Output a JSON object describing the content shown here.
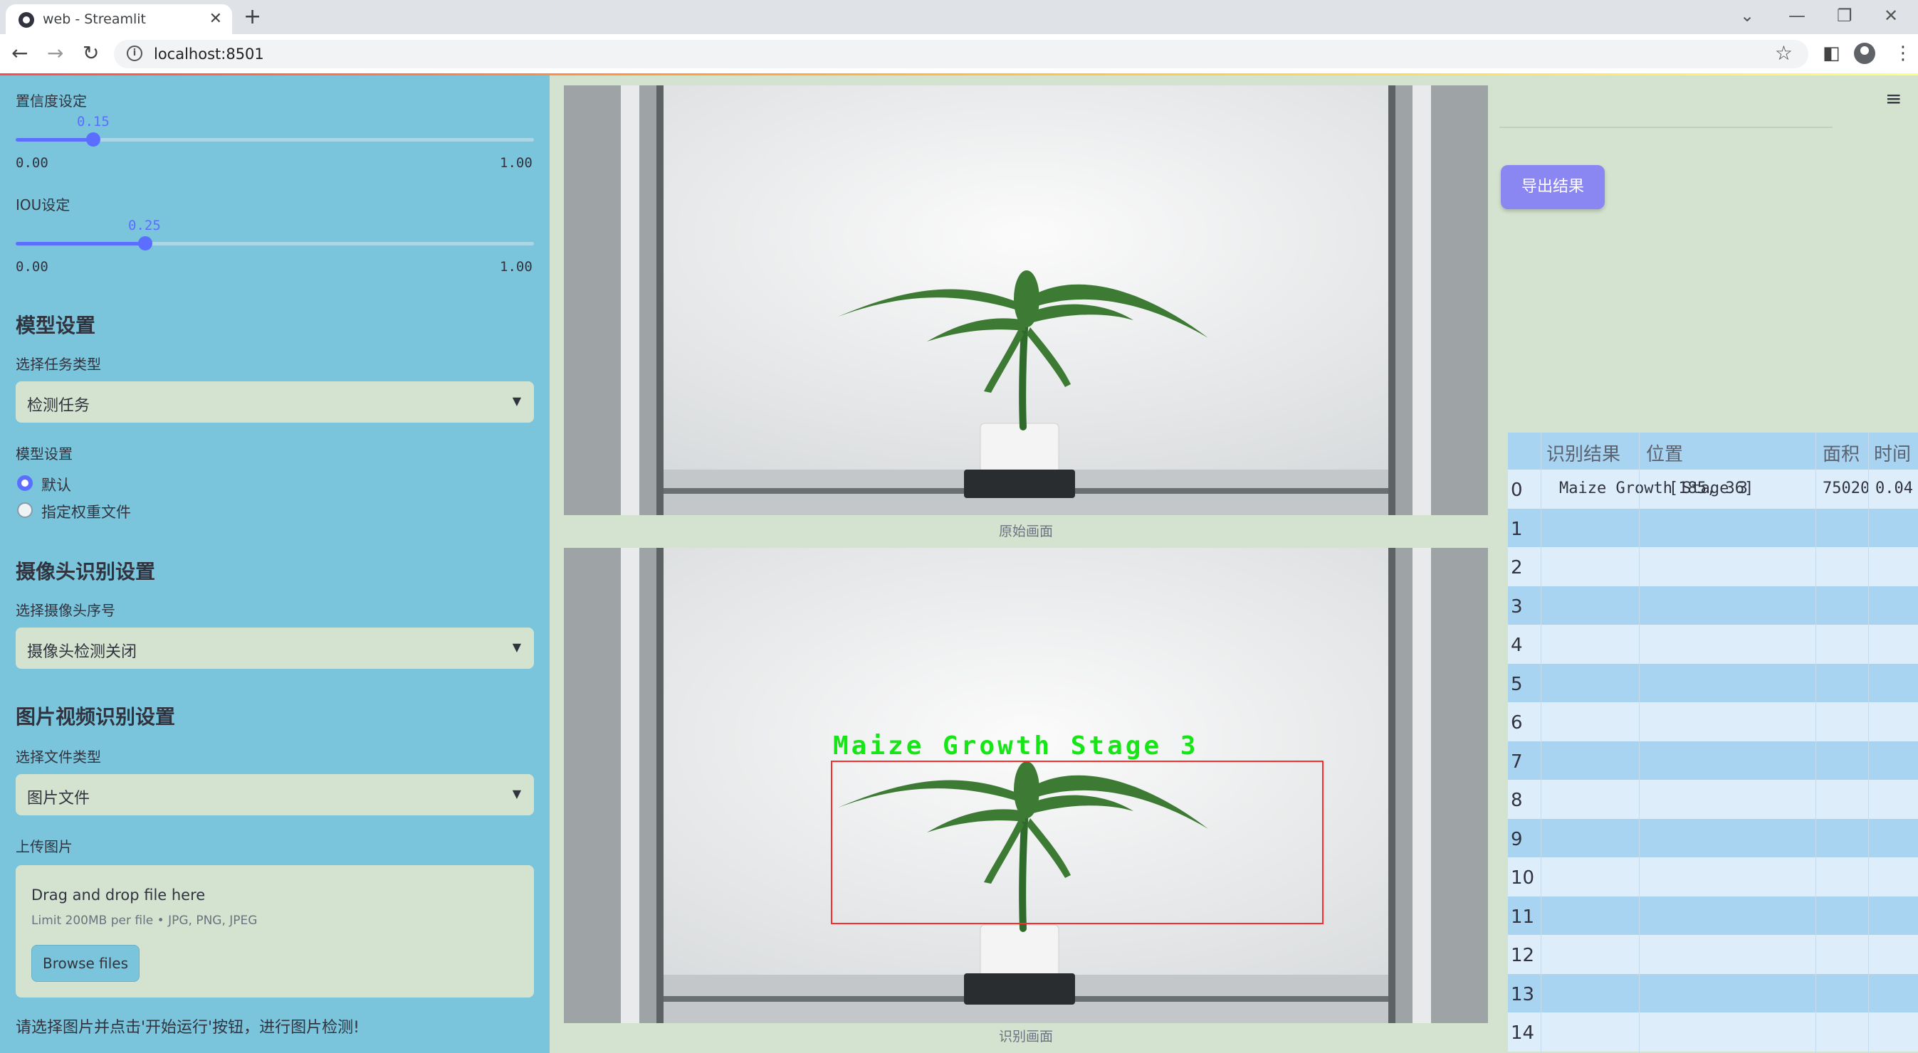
{
  "browser": {
    "tab_title": "web - Streamlit",
    "url": "localhost:8501"
  },
  "sidebar": {
    "confidence": {
      "label": "置信度设定",
      "value": "0.15",
      "min": "0.00",
      "max": "1.00",
      "fraction": 0.15
    },
    "iou": {
      "label": "IOU设定",
      "value": "0.25",
      "min": "0.00",
      "max": "1.00",
      "fraction": 0.25
    },
    "model_section": "模型设置",
    "task_label": "选择任务类型",
    "task_value": "检测任务",
    "model_label": "模型设置",
    "model_options": [
      "默认",
      "指定权重文件"
    ],
    "model_selected": 0,
    "camera_section": "摄像头识别设置",
    "camera_label": "选择摄像头序号",
    "camera_value": "摄像头检测关闭",
    "media_section": "图片视频识别设置",
    "filetype_label": "选择文件类型",
    "filetype_value": "图片文件",
    "upload_label": "上传图片",
    "upload_title": "Drag and drop file here",
    "upload_limit": "Limit 200MB per file • JPG, PNG, JPEG",
    "browse_label": "Browse files",
    "hint": "请选择图片并点击'开始运行'按钮，进行图片检测!"
  },
  "main": {
    "original_caption": "原始画面",
    "result_caption": "识别画面",
    "detection_label": "Maize Growth Stage 3"
  },
  "right": {
    "export_label": "导出结果",
    "table": {
      "headers": [
        "识别结果",
        "位置",
        "面积",
        "时间"
      ],
      "rows": [
        {
          "index": "0",
          "result": "Maize Growth Stage 3",
          "position": "[185, 36]",
          "area": "75020",
          "time": "0.04"
        },
        {
          "index": "1"
        },
        {
          "index": "2"
        },
        {
          "index": "3"
        },
        {
          "index": "4"
        },
        {
          "index": "5"
        },
        {
          "index": "6"
        },
        {
          "index": "7"
        },
        {
          "index": "8"
        },
        {
          "index": "9"
        },
        {
          "index": "10"
        },
        {
          "index": "11"
        },
        {
          "index": "12"
        },
        {
          "index": "13"
        },
        {
          "index": "14"
        }
      ]
    }
  },
  "colors": {
    "sidebar_bg": "#7ac5dc",
    "main_bg": "#d4e3cf",
    "accent": "#5b6eff",
    "export_button": "#8b87f2",
    "detection_box": "#ff2a2a",
    "detection_text": "#16e616"
  }
}
